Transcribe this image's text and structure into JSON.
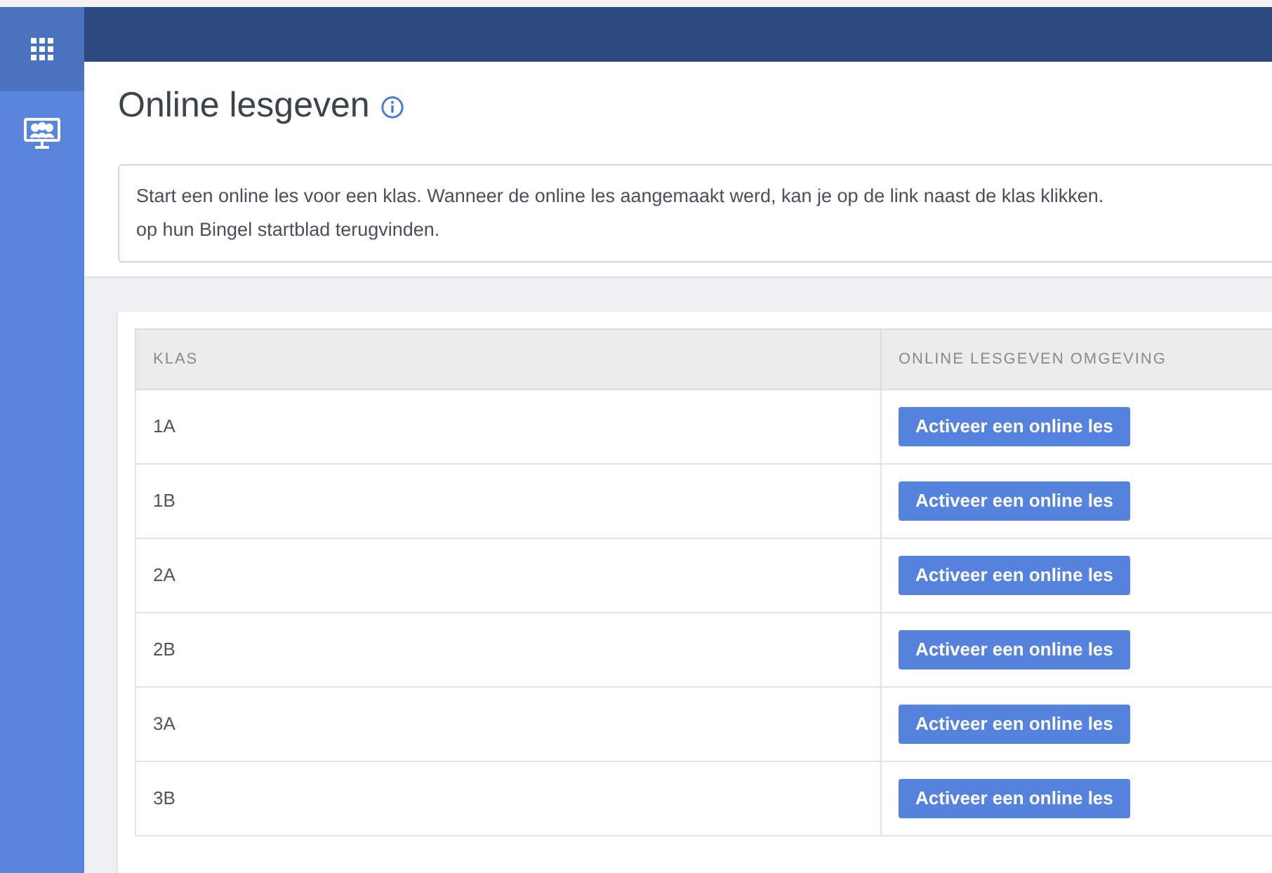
{
  "page": {
    "title": "Online lesgeven"
  },
  "intro": {
    "lines": [
      "Start een online les voor een klas. Wanneer de online les aangemaakt werd, kan je op de link naast de klas klikken.",
      "op hun Bingel startblad terugvinden."
    ]
  },
  "table": {
    "columns": [
      "KLAS",
      "ONLINE LESGEVEN OMGEVING"
    ],
    "rows": [
      {
        "klas": "1A",
        "action": "Activeer een online les"
      },
      {
        "klas": "1B",
        "action": "Activeer een online les"
      },
      {
        "klas": "2A",
        "action": "Activeer een online les"
      },
      {
        "klas": "2B",
        "action": "Activeer een online les"
      },
      {
        "klas": "3A",
        "action": "Activeer een online les"
      },
      {
        "klas": "3B",
        "action": "Activeer een online les"
      }
    ]
  }
}
